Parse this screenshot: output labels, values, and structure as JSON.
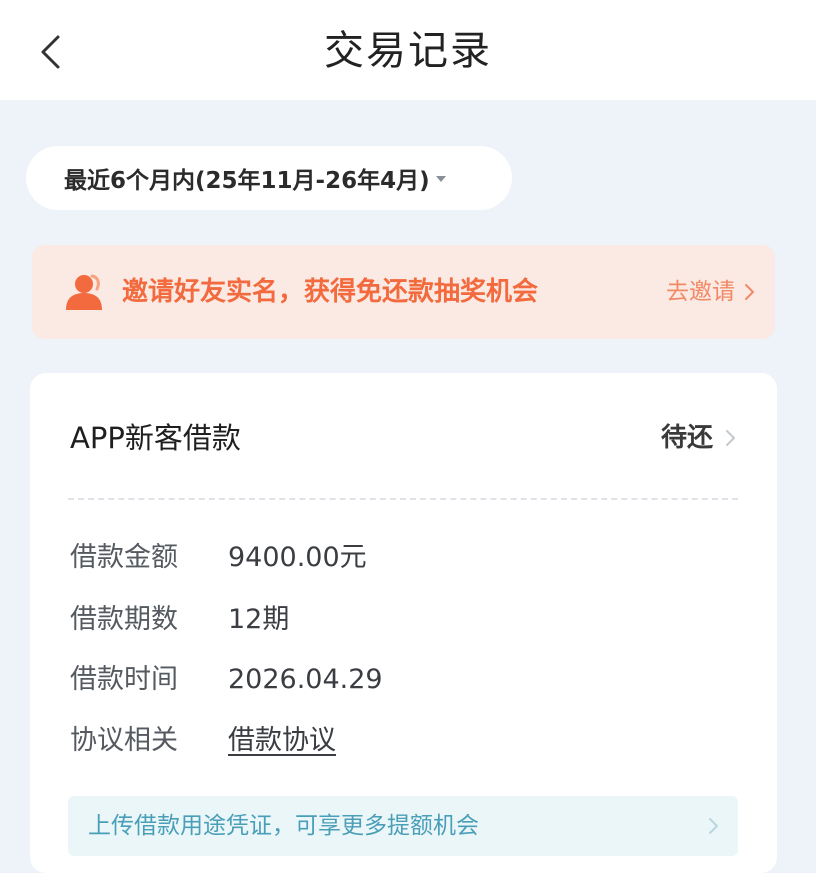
{
  "header": {
    "title": "交易记录",
    "back_icon": "chevron-left-icon"
  },
  "filter": {
    "label": "最近6个月内(25年11月-26年4月)",
    "caret_icon": "caret-down-icon"
  },
  "banner": {
    "icon": "user-icon",
    "text": "邀请好友实名，获得免还款抽奖机会",
    "action_label": "去邀请",
    "chevron_icon": "chevron-right-icon",
    "accent_color": "#f26a3d"
  },
  "loan_card": {
    "title": "APP新客借款",
    "status": "待还",
    "details": [
      {
        "label": "借款金额",
        "value": "9400.00元"
      },
      {
        "label": "借款期数",
        "value": "12期"
      },
      {
        "label": "借款时间",
        "value": "2026.04.29"
      },
      {
        "label": "协议相关",
        "value": "借款协议"
      }
    ],
    "upload_hint": "上传借款用途凭证，可享更多提额机会"
  }
}
